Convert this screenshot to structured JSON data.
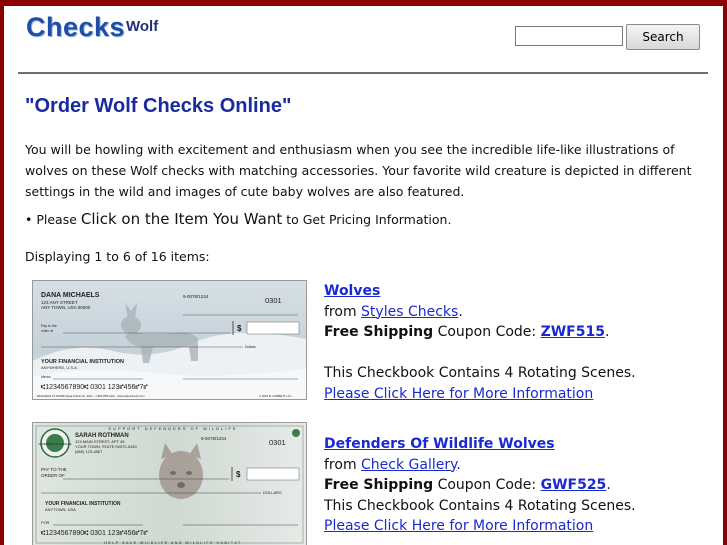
{
  "header": {
    "logo_text": "Checks",
    "subtitle": "Wolf",
    "search": {
      "value": "",
      "placeholder": ""
    },
    "search_button": "Search"
  },
  "main": {
    "title": "\"Order Wolf Checks Online\"",
    "intro": "You will be howling with excitement and enthusiasm when you see the incredible life-like illustrations of wolves on these Wolf checks with matching accessories. Your favorite wild creature is depicted in different settings in the wild and images of cute baby wolves are also featured.",
    "bullet_prefix": "• Please ",
    "bullet_big": "Click on the Item You Want",
    "bullet_suffix": " to Get Pricing Information.",
    "displaying": "Displaying 1 to 6 of 16 items:"
  },
  "items": [
    {
      "title": "Wolves",
      "from_label": "from ",
      "source": "Styles Checks",
      "after_source": ".",
      "shipping_label": "Free Shipping",
      "coupon_label": " Coupon Code: ",
      "coupon_code": "ZWF515",
      "after_code": ".",
      "description": "This Checkbook Contains 4 Rotating Scenes.",
      "more_link": "Please Click Here for More Information",
      "check": {
        "name": "DANA MICHAELS",
        "addr1": "123 ANY STREET",
        "addr2": "ANY TOWN, USA 00000",
        "routing": "9-0078/1234",
        "number": "0301",
        "pay_to": "Pay to the",
        "order_of": "order of",
        "dollar": "$",
        "dollars": "Dollars",
        "bank": "YOUR FINANCIAL INSTITUTION",
        "bank_city": "ANYWHERE, U.S.A.",
        "memo": "Memo",
        "micr": "⑆1234567890⑆ 0301 123⑈456⑈7⑈",
        "footer": "MICHAELS AT WORK Dana Check Co. 2011 · 1-800-555-0111 · www.stylescheck.com",
        "copyright": "© 2001 B. CORBETT LLC"
      }
    },
    {
      "title": "Defenders Of Wildlife Wolves",
      "from_label": "from ",
      "source": "Check Gallery",
      "after_source": ".",
      "shipping_label": "Free Shipping",
      "coupon_label": " Coupon Code: ",
      "coupon_code": "GWF525",
      "after_code": ".",
      "description": "This Checkbook Contains 4 Rotating Scenes.",
      "more_link": "Please Click Here for More Information",
      "check": {
        "top_banner": "SUPPORT DEFENDERS OF WILDLIFE",
        "name": "SARAH ROTHMAN",
        "addr1": "123 MAIN STREET, APT 45",
        "addr2": "YOUR TOWN, STATE 00070-0430",
        "phone": "(860) 123-4567",
        "routing": "9-0078/1234",
        "number": "0301",
        "pay_to": "PAY TO THE",
        "order_of": "ORDER OF",
        "dollar": "$",
        "dollars": "DOLLARS",
        "bank": "YOUR FINANCIAL INSTITUTION",
        "bank_city": "ANYTOWN, USA",
        "memo": "FOR",
        "micr": "⑆1234567890⑆ 0301 123⑈456⑈7⑈",
        "bottom_banner": "HELP SAVE WILDLIFE AND WILDLIFE HABITAT",
        "seal_text": "DEFENDERS OF WILDLIFE"
      }
    }
  ],
  "colors": {
    "frame": "#8b0000",
    "link": "#1a2ad0",
    "title": "#1a2aa0",
    "logo": "#1f4ea8"
  }
}
